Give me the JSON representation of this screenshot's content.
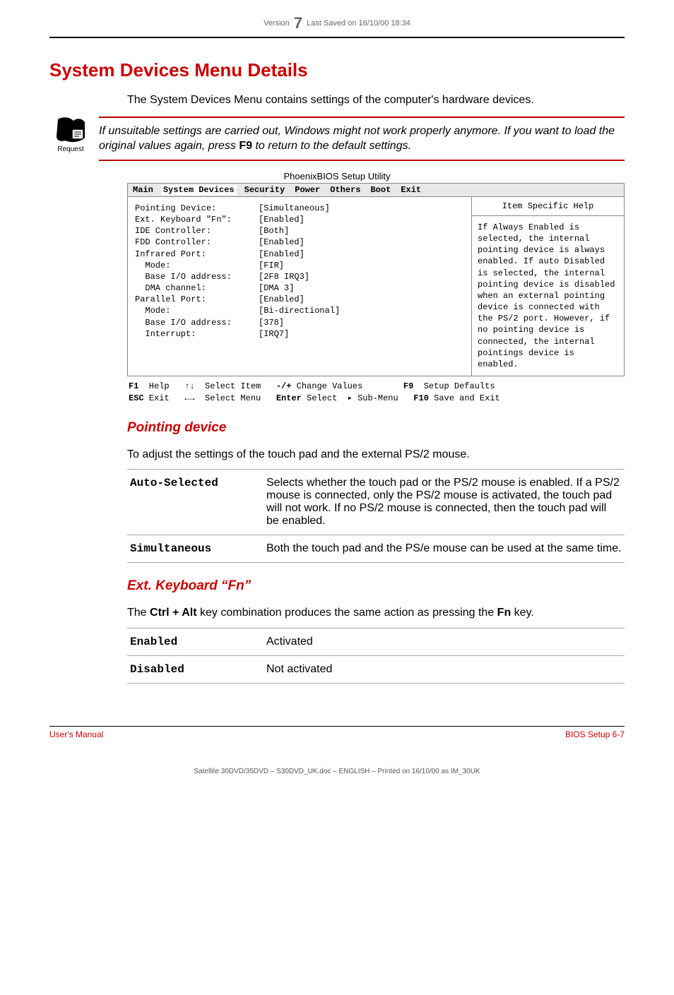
{
  "header": {
    "version_pre": "Version",
    "version_num": "7",
    "version_post": "Last Saved on 16/10/00 18:34"
  },
  "title": "System Devices Menu Details",
  "intro": "The System Devices Menu contains settings of the computer's hardware devices.",
  "request": {
    "label": "Request",
    "text_pre": "If unsuitable settings are carried out, Windows might not work properly anymore. If you want to load the original values again, press ",
    "f9": "F9",
    "text_post": " to return to the default settings."
  },
  "bios": {
    "caption": "PhoenixBIOS Setup Utility",
    "tabs": [
      "Main",
      "System Devices",
      "Security",
      "Power",
      "Others",
      "Boot",
      "Exit"
    ],
    "rows": [
      {
        "label": "Pointing Device:",
        "value": "[Simultaneous]"
      },
      {
        "label": "Ext. Keyboard \"Fn\":",
        "value": "[Enabled]"
      },
      {
        "label": "IDE Controller:",
        "value": "[Both]"
      },
      {
        "label": "FDD Controller:",
        "value": "[Enabled]"
      },
      {
        "label": "",
        "value": ""
      },
      {
        "label": "Infrared Port:",
        "value": "[Enabled]"
      },
      {
        "label": "  Mode:",
        "value": "[FIR]"
      },
      {
        "label": "  Base I/O address:",
        "value": "[2F8 IRQ3]"
      },
      {
        "label": "  DMA channel:",
        "value": "[DMA 3]"
      },
      {
        "label": "Parallel Port:",
        "value": "[Enabled]"
      },
      {
        "label": "  Mode:",
        "value": "[Bi-directional]"
      },
      {
        "label": "  Base I/O address:",
        "value": "[378]"
      },
      {
        "label": "  Interrupt:",
        "value": "[IRQ7]"
      }
    ],
    "help_header": "Item Specific Help",
    "help_body": "If Always Enabled is selected, the internal pointing device is always enabled. If auto Disabled is selected, the internal pointing device is disabled when an external pointing device is connected with the PS/2 port.\nHowever, if no pointing device is connected, the internal pointings device is enabled.",
    "footer": {
      "f1": "F1",
      "help": "Help",
      "select_item": "Select Item",
      "change_values": "Change Values",
      "f9": "F9",
      "setup_defaults": "Setup Defaults",
      "esc": "ESC",
      "exit": "Exit",
      "select_menu": "Select Menu",
      "enter": "Enter",
      "select_submenu": "Select  ▸ Sub-Menu",
      "f10": "F10",
      "save_exit": "Save and Exit"
    }
  },
  "sections": {
    "pointing": {
      "title": "Pointing device",
      "desc": "To adjust the settings of the touch pad and the external PS/2 mouse.",
      "rows": [
        {
          "key": "Auto-Selected",
          "val": "Selects whether the touch pad or the PS/2 mouse is enabled. If a PS/2 mouse is connected, only the PS/2 mouse is activated, the touch pad will not work. If no PS/2 mouse is connected, then the touch pad will be enabled."
        },
        {
          "key": "Simultaneous",
          "val": "Both the touch pad and the PS/e mouse can be used at the same time."
        }
      ]
    },
    "extkb": {
      "title": "Ext. Keyboard “Fn”",
      "desc_pre": "The ",
      "desc_keys": "Ctrl + Alt",
      "desc_mid": " key combination produces the same action as pressing the ",
      "desc_fn": "Fn",
      "desc_post": " key.",
      "rows": [
        {
          "key": "Enabled",
          "val": "Activated"
        },
        {
          "key": "Disabled",
          "val": "Not activated"
        }
      ]
    }
  },
  "footer": {
    "left": "User's Manual",
    "right": "BIOS Setup  6-7"
  },
  "printline": "Satellite 30DVD/35DVD  – S30DVD_UK.doc – ENGLISH – Printed on 16/10/00 as IM_30UK"
}
